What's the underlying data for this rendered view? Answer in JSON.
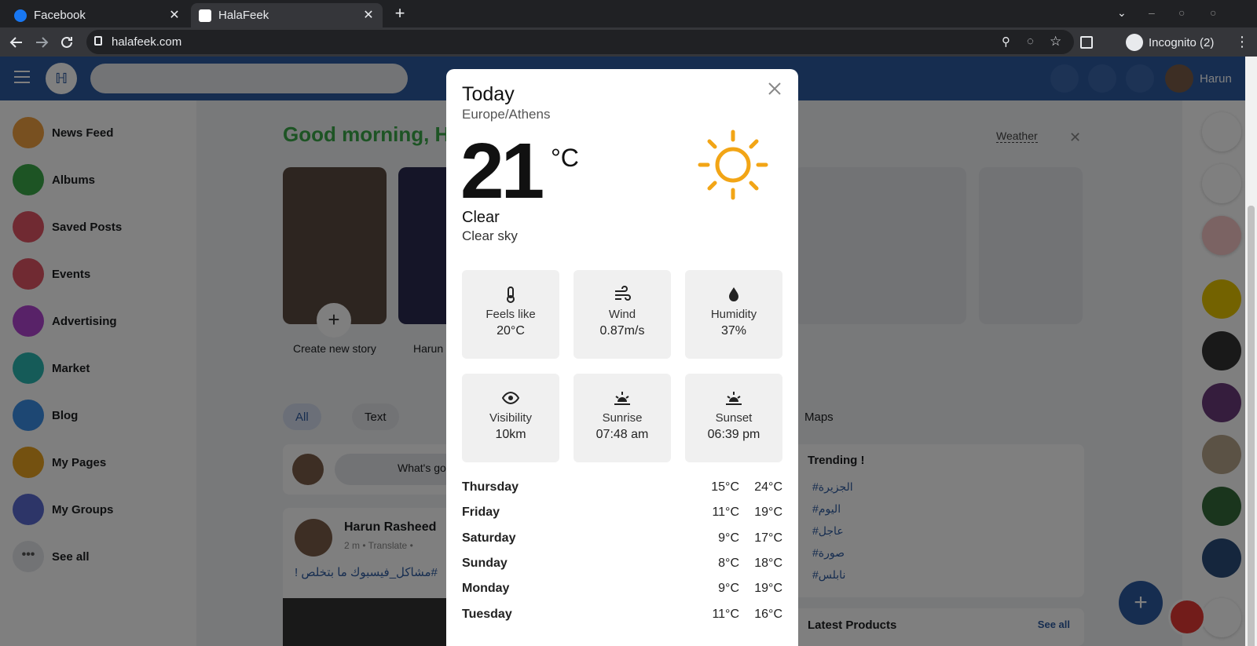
{
  "browser": {
    "tabs": [
      {
        "title": "Facebook",
        "active": false
      },
      {
        "title": "HalaFeek",
        "active": true
      }
    ],
    "url": "halafeek.com",
    "incognito_label": "Incognito (2)"
  },
  "header": {
    "user_name": "Harun"
  },
  "sidebar": {
    "items": [
      {
        "label": "News Feed",
        "color": "#f0a040"
      },
      {
        "label": "Albums",
        "color": "#3aa849"
      },
      {
        "label": "Saved Posts",
        "color": "#e05565"
      },
      {
        "label": "Events",
        "color": "#e05565"
      },
      {
        "label": "Advertising",
        "color": "#b044d0"
      },
      {
        "label": "Market",
        "color": "#2bb6b0"
      },
      {
        "label": "Blog",
        "color": "#3a8ee6"
      },
      {
        "label": "My Pages",
        "color": "#e8a220"
      },
      {
        "label": "My Groups",
        "color": "#5a6ad0"
      },
      {
        "label": "See all",
        "color": "#e4e6eb"
      }
    ]
  },
  "main": {
    "greeting": "Good morning, Ha",
    "weather_link": "Weather",
    "stories": [
      {
        "label": "Create new story"
      },
      {
        "label": "Harun"
      }
    ],
    "filter_tabs": [
      "All",
      "Text",
      "Maps"
    ],
    "composer_placeholder": "What's go",
    "post": {
      "author": "Harun Rasheed",
      "meta": "2 m • Translate •",
      "text": "#مشاكل_فيسبوك ما بتخلص !"
    },
    "trending": {
      "title": "Trending !",
      "tags": [
        "#الجزيرة",
        "#اليوم",
        "#عاجل",
        "#صورة",
        "#نابلس"
      ]
    },
    "latest_products": "Latest Products",
    "see_all": "See all"
  },
  "weather_modal": {
    "title": "Today",
    "timezone": "Europe/Athens",
    "temperature": "21",
    "unit": "°C",
    "condition": "Clear",
    "description": "Clear sky",
    "icon": "sun-icon",
    "stats": [
      {
        "label": "Feels like",
        "value": "20°C",
        "icon": "thermometer-icon"
      },
      {
        "label": "Wind",
        "value": "0.87m/s",
        "icon": "wind-icon"
      },
      {
        "label": "Humidity",
        "value": "37%",
        "icon": "humidity-icon"
      },
      {
        "label": "Visibility",
        "value": "10km",
        "icon": "eye-icon"
      },
      {
        "label": "Sunrise",
        "value": "07:48 am",
        "icon": "sunrise-icon"
      },
      {
        "label": "Sunset",
        "value": "06:39 pm",
        "icon": "sunset-icon"
      }
    ],
    "forecast": [
      {
        "day": "Thursday",
        "low": "15°C",
        "high": "24°C"
      },
      {
        "day": "Friday",
        "low": "11°C",
        "high": "19°C"
      },
      {
        "day": "Saturday",
        "low": "9°C",
        "high": "17°C"
      },
      {
        "day": "Sunday",
        "low": "8°C",
        "high": "18°C"
      },
      {
        "day": "Monday",
        "low": "9°C",
        "high": "19°C"
      },
      {
        "day": "Tuesday",
        "low": "11°C",
        "high": "16°C"
      }
    ]
  },
  "colors": {
    "brand": "#2d5aa0",
    "greeting": "#3aa849",
    "sun": "#f2a516"
  }
}
